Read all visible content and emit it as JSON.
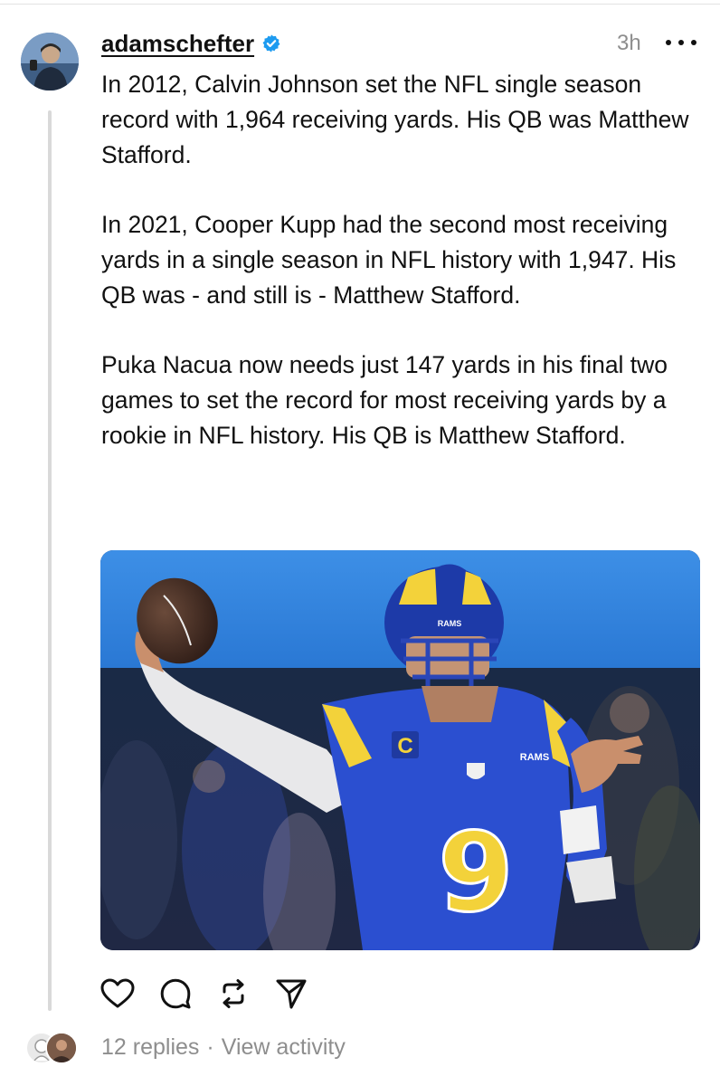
{
  "post": {
    "username": "adamschefter",
    "time": "3h",
    "paragraphs": [
      "In 2012, Calvin Johnson set the NFL single season record with 1,964 receiving yards. His QB was Matthew Stafford.",
      "In 2021, Cooper Kupp had the second most receiving yards in a single season in NFL history with 1,947. His QB was - and still is - Matthew Stafford.",
      "Puka Nacua now needs just 147 yards in his final two games to set the record for most receiving yards by a rookie in NFL history. His QB is Matthew Stafford."
    ],
    "photo": {
      "helmet_text": "RAMS",
      "chest_text": "RAMS",
      "jersey_number": "9",
      "captain_patch": "C"
    }
  },
  "actions": {
    "icons": [
      "heart-icon",
      "comment-icon",
      "repost-icon",
      "share-icon"
    ]
  },
  "footer": {
    "replies": "12 replies",
    "separator": "·",
    "activity": "View activity"
  },
  "colors": {
    "verified": "#1d9bf0",
    "secondary_text": "#8e8e8e",
    "jersey_blue": "#2b4fd0",
    "rams_yellow": "#f3d23a"
  }
}
